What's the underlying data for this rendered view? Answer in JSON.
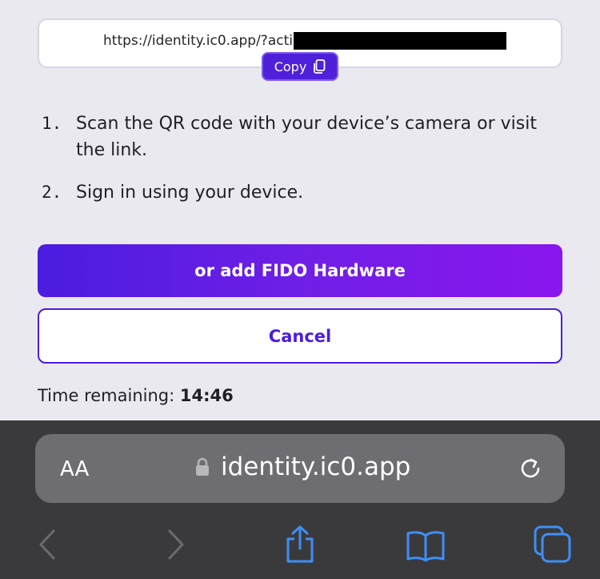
{
  "url_box": {
    "url_text": "https://identity.ic0.app/?actio",
    "copy_label": "Copy"
  },
  "steps": [
    {
      "num": "1.",
      "text": "Scan the QR code with your device’s camera or visit the link."
    },
    {
      "num": "2.",
      "text": "Sign in using your device."
    }
  ],
  "buttons": {
    "fido_label": "or add FIDO Hardware",
    "cancel_label": "Cancel"
  },
  "timer": {
    "label": "Time remaining:",
    "value": "14:46"
  },
  "browser": {
    "text_size_label": "AA",
    "address": "identity.ic0.app",
    "icons": [
      "lock-icon",
      "reload-icon",
      "back-icon",
      "forward-icon",
      "share-icon",
      "bookmarks-icon",
      "tabs-icon"
    ]
  },
  "colors": {
    "accent": "#4b1ce0",
    "gradient_end": "#8a16ee",
    "toolbar_bg": "#3a3a3c",
    "ios_blue": "#3e8ff6"
  }
}
